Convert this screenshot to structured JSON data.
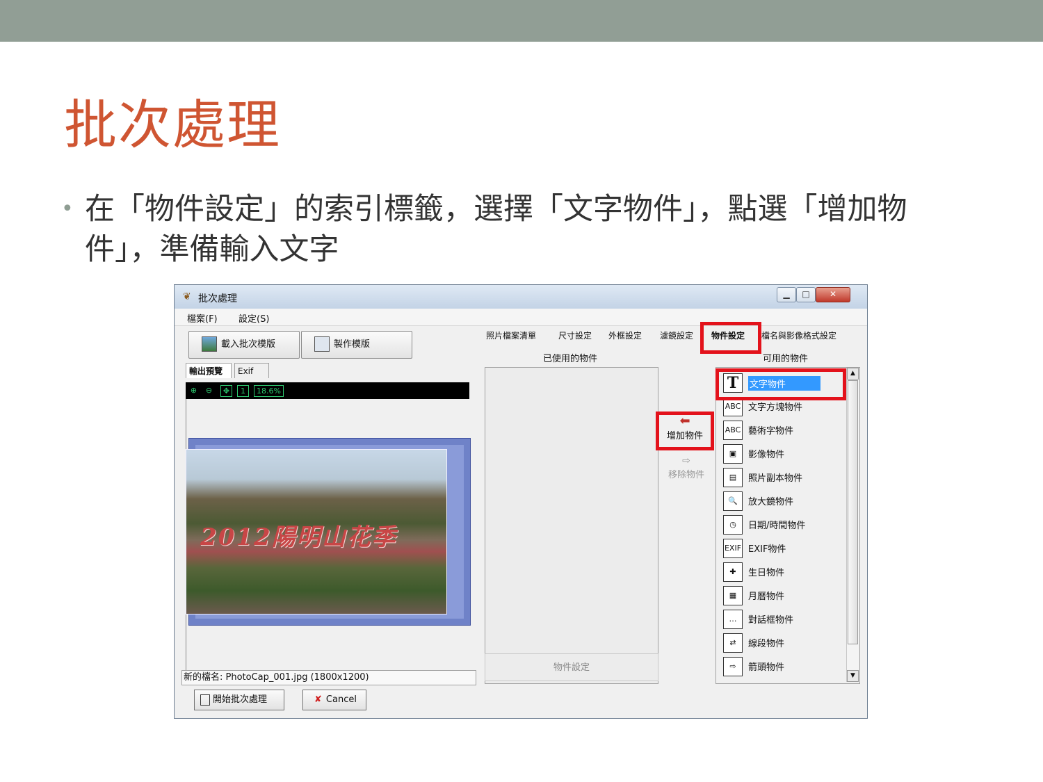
{
  "slide": {
    "title": "批次處理",
    "bullet": "在「物件設定」的索引標籤，選擇「文字物件」，點選「增加物件」，準備輸入文字",
    "colors": {
      "topbar": "#919e95",
      "title": "#cf5532",
      "highlight": "#e3121b"
    }
  },
  "window": {
    "title": "批次處理",
    "app_icon": "photocap-icon",
    "menu": [
      "檔案(F)",
      "設定(S)"
    ],
    "load_template_label": "載入批次模版",
    "make_template_label": "製作模版",
    "preview_tabs": [
      "輸出預覽",
      "Exif"
    ],
    "zoom_level": "18.6%",
    "photo_caption": "2012陽明山花季",
    "status": "新的檔名: PhotoCap_001.jpg (1800x1200)",
    "start_label": "開始批次處理",
    "cancel_label": "Cancel",
    "right_tabs": [
      "照片檔案清單",
      "尺寸設定",
      "外框設定",
      "濾鏡設定",
      "物件設定",
      "檔名與影像格式設定"
    ],
    "active_right_tab": "物件設定",
    "used_header": "已使用的物件",
    "available_header": "可用的物件",
    "add_label": "增加物件",
    "remove_label": "移除物件",
    "object_settings_label": "物件設定",
    "available_objects": [
      {
        "label": "文字物件",
        "icon": "text-T-icon",
        "glyph": "T",
        "selected": true
      },
      {
        "label": "文字方塊物件",
        "icon": "text-box-icon",
        "glyph": "ABC"
      },
      {
        "label": "藝術字物件",
        "icon": "art-text-icon",
        "glyph": "ABC"
      },
      {
        "label": "影像物件",
        "icon": "image-icon",
        "glyph": "▣"
      },
      {
        "label": "照片副本物件",
        "icon": "photo-copy-icon",
        "glyph": "▤"
      },
      {
        "label": "放大鏡物件",
        "icon": "magnifier-icon",
        "glyph": "🔍"
      },
      {
        "label": "日期/時間物件",
        "icon": "clock-icon",
        "glyph": "◷"
      },
      {
        "label": "EXIF物件",
        "icon": "exif-icon",
        "glyph": "EXIF"
      },
      {
        "label": "生日物件",
        "icon": "cake-icon",
        "glyph": "✚"
      },
      {
        "label": "月曆物件",
        "icon": "calendar-icon",
        "glyph": "▦"
      },
      {
        "label": "對話框物件",
        "icon": "speech-bubble-icon",
        "glyph": "…"
      },
      {
        "label": "線段物件",
        "icon": "line-icon",
        "glyph": "⇄"
      },
      {
        "label": "箭頭物件",
        "icon": "arrow-icon",
        "glyph": "⇨"
      }
    ]
  }
}
